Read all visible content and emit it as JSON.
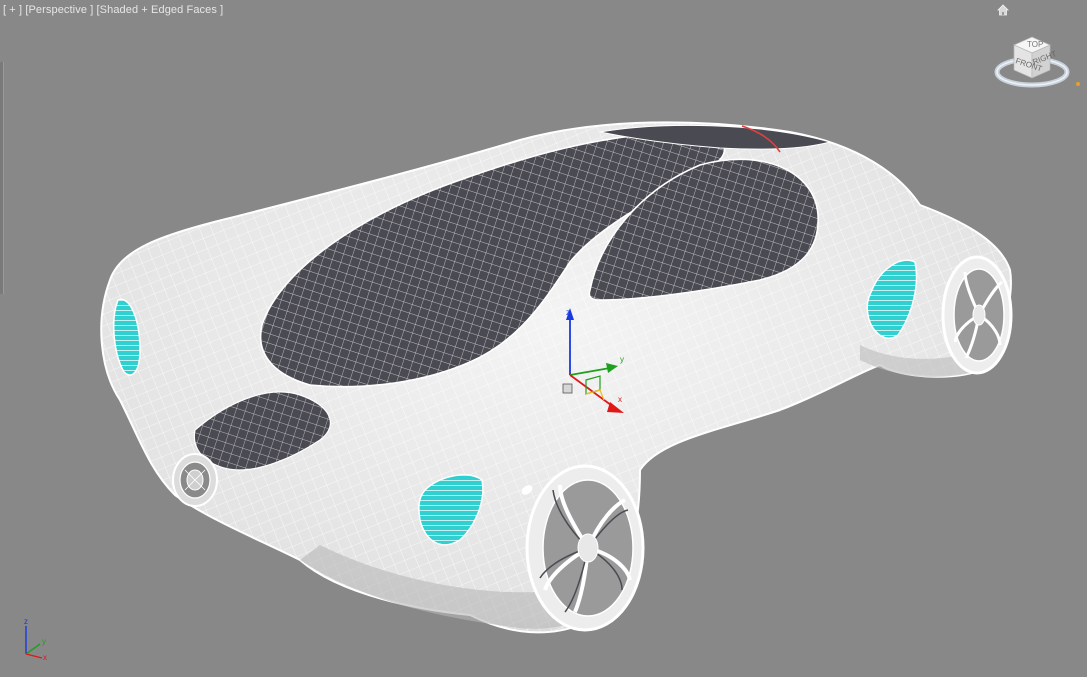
{
  "viewport": {
    "label": {
      "plus_menu": "[ + ]",
      "view_menu": "[Perspective ]",
      "shading_menu": "[Shaded + Edged Faces ]"
    },
    "home_icon": "home-icon",
    "viewcube": {
      "face_front": "FRONT",
      "face_right": "RIGHT",
      "face_top": "TOP"
    },
    "gizmo_axes": {
      "x": "x",
      "y": "y",
      "z": "z"
    },
    "world_axes": {
      "x": "x",
      "y": "y",
      "z": "z"
    }
  },
  "colors": {
    "background": "#888888",
    "body_shell": "#efefef",
    "glass": "#4a4a52",
    "wire": "#ffffff",
    "intake": "#2fd0cf",
    "axis_x": "#e01818",
    "axis_y": "#1ea01e",
    "axis_z": "#1a3ae0",
    "selected_edge": "#e04040"
  }
}
